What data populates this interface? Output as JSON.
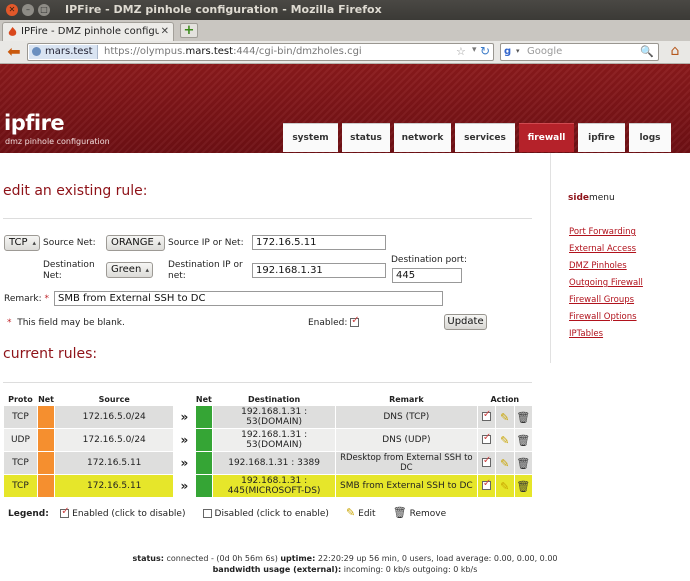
{
  "window": {
    "title": "IPFire - DMZ pinhole configuration - Mozilla Firefox",
    "controls": [
      "close",
      "minimize",
      "maximize"
    ]
  },
  "browser": {
    "tab_title": "IPFire - DMZ pinhole configura...",
    "new_tab_symbol": "+",
    "identity_label": "mars.test",
    "url_prefix": "https://olympus.",
    "url_host_bold": "mars.test",
    "url_suffix": ":444/cgi-bin/dmzholes.cgi",
    "search_placeholder": "Google",
    "search_engine_letter": "g"
  },
  "header": {
    "logo": "ipfire",
    "subtitle": "dmz pinhole configuration",
    "tabs": [
      {
        "label": "system",
        "active": false
      },
      {
        "label": "status",
        "active": false
      },
      {
        "label": "network",
        "active": false
      },
      {
        "label": "services",
        "active": false
      },
      {
        "label": "firewall",
        "active": true
      },
      {
        "label": "ipfire",
        "active": false
      },
      {
        "label": "logs",
        "active": false
      }
    ]
  },
  "form": {
    "title": "edit an existing rule:",
    "protocol_value": "TCP",
    "source_net_label": "Source Net:",
    "source_net_value": "ORANGE",
    "source_ip_label": "Source IP or Net:",
    "source_ip_value": "172.16.5.11",
    "dest_net_label_1": "Destination",
    "dest_net_label_2": "Net:",
    "dest_net_value": "Green",
    "dest_ip_label_1": "Destination IP or",
    "dest_ip_label_2": "net:",
    "dest_ip_value": "192.168.1.31",
    "dest_port_label": "Destination port:",
    "dest_port_value": "445",
    "remark_label": "Remark:",
    "required_mark": "*",
    "remark_value": "SMB from External SSH to DC",
    "blank_note": "This field may be blank.",
    "enabled_label": "Enabled:",
    "enabled_checked": true,
    "update_button": "Update"
  },
  "rules": {
    "title": "current rules:",
    "headers": {
      "proto": "Proto",
      "net": "Net",
      "source": "Source",
      "net2": "Net",
      "destination": "Destination",
      "remark": "Remark",
      "action": "Action"
    },
    "rows": [
      {
        "proto": "TCP",
        "source": "172.16.5.0/24",
        "destination": "192.168.1.31 : 53(DOMAIN)",
        "remark": "DNS (TCP)",
        "highlight": false
      },
      {
        "proto": "UDP",
        "source": "172.16.5.0/24",
        "destination": "192.168.1.31 : 53(DOMAIN)",
        "remark": "DNS (UDP)",
        "highlight": false
      },
      {
        "proto": "TCP",
        "source": "172.16.5.11",
        "destination": "192.168.1.31 : 3389",
        "remark": "RDesktop from External SSH to DC",
        "highlight": false
      },
      {
        "proto": "TCP",
        "source": "172.16.5.11",
        "destination_line1": "192.168.1.31 :",
        "destination_line2": "445(MICROSOFT-DS)",
        "remark": "SMB from External SSH to DC",
        "highlight": true
      }
    ],
    "colors": {
      "orange": "#f58f2f",
      "green": "#35a535",
      "highlight": "#e6e62a"
    }
  },
  "legend": {
    "label": "Legend:",
    "enabled": "Enabled (click to disable)",
    "disabled": "Disabled (click to enable)",
    "edit": "Edit",
    "remove": "Remove"
  },
  "sidemenu": {
    "title_bold": "side",
    "title_rest": "menu",
    "items": [
      "Port Forwarding",
      "External Access",
      "DMZ Pinholes",
      "Outgoing Firewall",
      "Firewall Groups",
      "Firewall Options",
      "IPTables"
    ]
  },
  "footer": {
    "status_label": "status:",
    "status_text": "connected - (0d 0h 56m 6s)",
    "uptime_label": "uptime:",
    "uptime_text": "22:20:29 up 56 min, 0 users, load average: 0.00, 0.00, 0.00",
    "bandwidth_label": "bandwidth usage (external):",
    "bandwidth_text": "incoming: 0 kb/s outgoing: 0 kb/s"
  }
}
